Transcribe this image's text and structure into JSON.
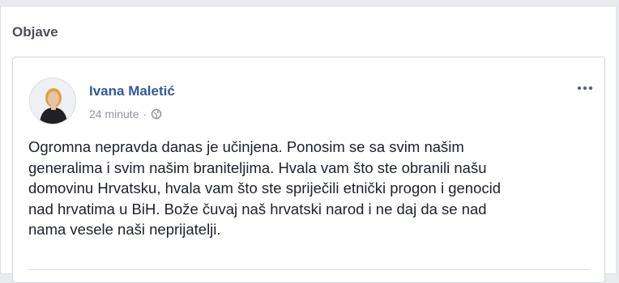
{
  "section": {
    "title": "Objave"
  },
  "post": {
    "author": "Ivana Maletić",
    "time": "24 minute",
    "separator": "·",
    "privacy_icon": "public-globe-icon",
    "text_lines": [
      "Ogromna nepravda danas je učinjena. Ponosim se sa svim našim",
      "generalima i svim našim braniteljima. Hvala vam što ste obranili našu",
      "domovinu Hrvatsku, hvala vam što ste spriječili etnički progon i genocid",
      "nad hrvatima u BiH. Bože čuvaj naš hrvatski narod i ne daj da se nad",
      "nama vesele naši neprijatelji."
    ],
    "more_icon": "more-options-icon"
  },
  "colors": {
    "author_link": "#365899",
    "meta_text": "#90949c",
    "body_text": "#1d2129",
    "page_bg": "#e9ebee"
  }
}
